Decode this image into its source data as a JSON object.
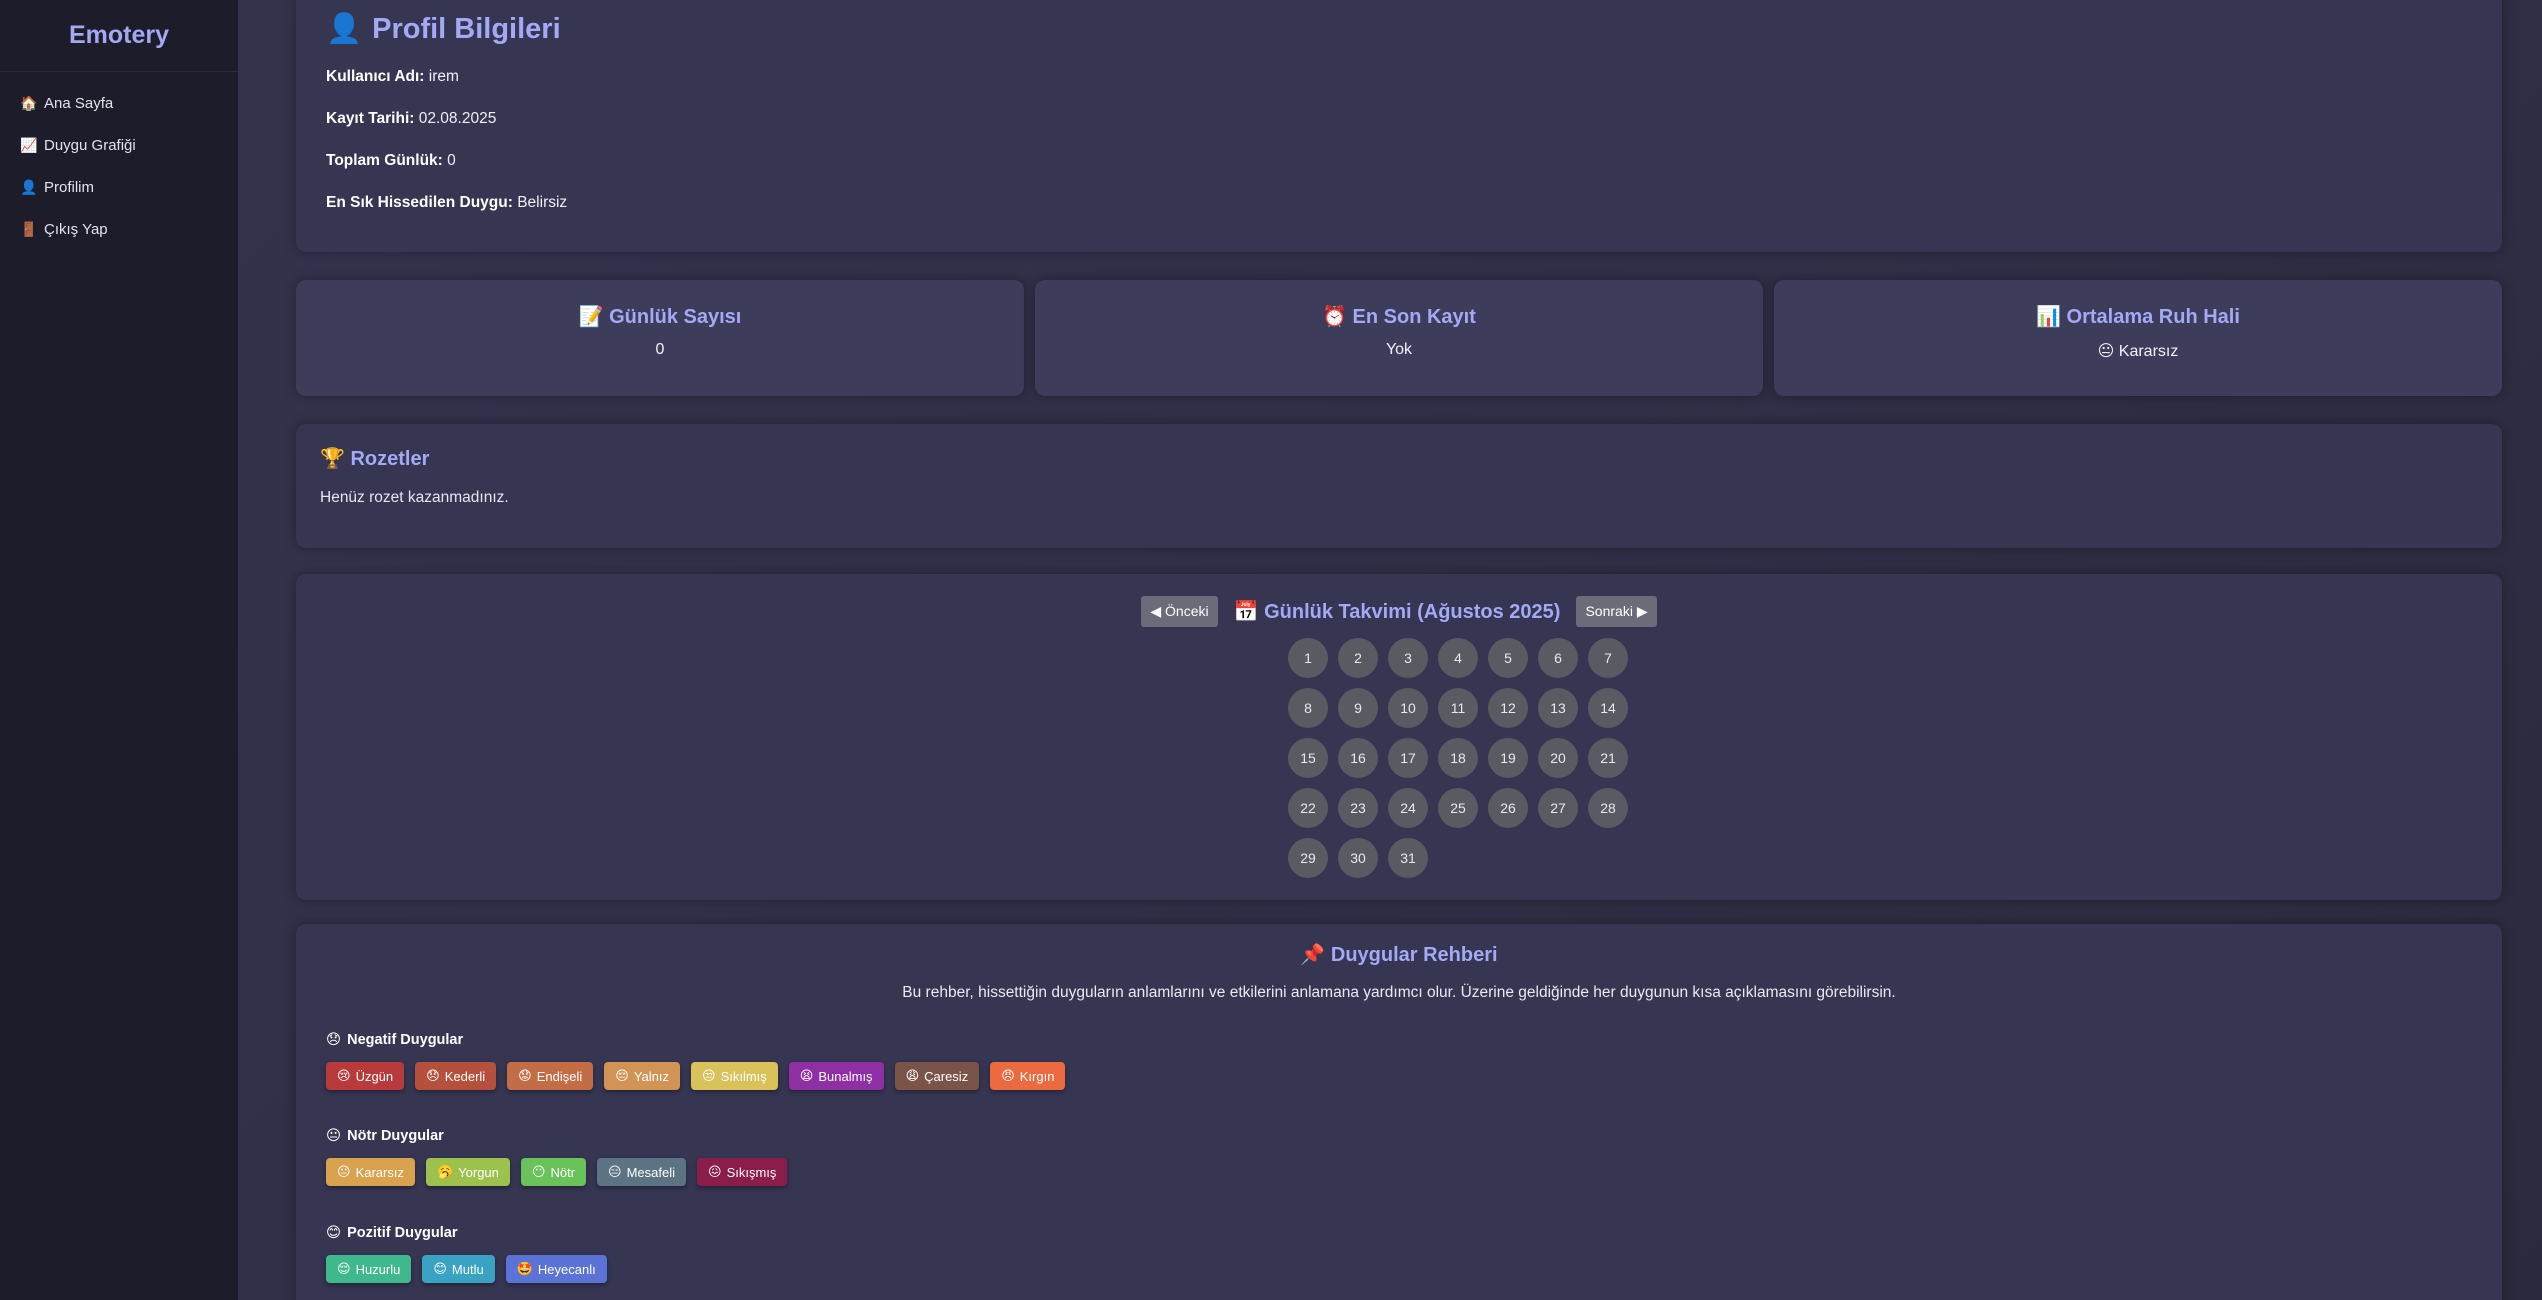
{
  "sidebar": {
    "brand": "Emotery",
    "items": [
      {
        "icon": "🏠",
        "label": "Ana Sayfa"
      },
      {
        "icon": "📈",
        "label": "Duygu Grafiği"
      },
      {
        "icon": "👤",
        "label": "Profilim"
      },
      {
        "icon": "🚪",
        "label": "Çıkış Yap"
      }
    ]
  },
  "profile": {
    "icon": "👤",
    "title": "Profil Bilgileri",
    "username_label": "Kullanıcı Adı:",
    "username": "irem",
    "register_label": "Kayıt Tarihi:",
    "register_date": "02.08.2025",
    "total_label": "Toplam Günlük:",
    "total": "0",
    "frequent_label": "En Sık Hissedilen Duygu:",
    "frequent": "Belirsiz"
  },
  "stats": [
    {
      "icon": "📝",
      "title": "Günlük Sayısı",
      "value": "0"
    },
    {
      "icon": "⏰",
      "title": "En Son Kayıt",
      "value": "Yok"
    },
    {
      "icon": "📊",
      "title": "Ortalama Ruh Hali",
      "value": "😐 Kararsız"
    }
  ],
  "badges": {
    "icon": "🏆",
    "title": "Rozetler",
    "empty_text": "Henüz rozet kazanmadınız."
  },
  "calendar": {
    "prev_label": "◀ Önceki",
    "next_label": "Sonraki ▶",
    "icon": "📅",
    "title": "Günlük Takvimi (Ağustos 2025)",
    "days": [
      "1",
      "2",
      "3",
      "4",
      "5",
      "6",
      "7",
      "8",
      "9",
      "10",
      "11",
      "12",
      "13",
      "14",
      "15",
      "16",
      "17",
      "18",
      "19",
      "20",
      "21",
      "22",
      "23",
      "24",
      "25",
      "26",
      "27",
      "28",
      "29",
      "30",
      "31"
    ]
  },
  "guide": {
    "icon": "📌",
    "title": "Duygular Rehberi",
    "description": "Bu rehber, hissettiğin duyguların anlamlarını ve etkilerini anlamana yardımcı olur. Üzerine geldiğinde her duygunun kısa açıklamasını görebilirsin.",
    "groups": [
      {
        "icon": "😞",
        "title": "Negatif Duygular",
        "items": [
          {
            "emoji": "😢",
            "label": "Üzgün",
            "color": "#b83a3a"
          },
          {
            "emoji": "😞",
            "label": "Kederli",
            "color": "#b5503c"
          },
          {
            "emoji": "😟",
            "label": "Endişeli",
            "color": "#c26d46"
          },
          {
            "emoji": "😔",
            "label": "Yalnız",
            "color": "#d19455"
          },
          {
            "emoji": "😒",
            "label": "Sıkılmış",
            "color": "#d9c25a"
          },
          {
            "emoji": "😫",
            "label": "Bunalmış",
            "color": "#8e2fa3"
          },
          {
            "emoji": "😩",
            "label": "Çaresiz",
            "color": "#7a5448"
          },
          {
            "emoji": "😠",
            "label": "Kırgın",
            "color": "#ec6a3f"
          }
        ]
      },
      {
        "icon": "😐",
        "title": "Nötr Duygular",
        "items": [
          {
            "emoji": "😐",
            "label": "Kararsız",
            "color": "#d9a24e"
          },
          {
            "emoji": "🥱",
            "label": "Yorgun",
            "color": "#9cc24d"
          },
          {
            "emoji": "😶",
            "label": "Nötr",
            "color": "#6ac25b"
          },
          {
            "emoji": "😑",
            "label": "Mesafeli",
            "color": "#5b7383"
          },
          {
            "emoji": "😖",
            "label": "Sıkışmış",
            "color": "#8a1d4a"
          }
        ]
      },
      {
        "icon": "😊",
        "title": "Pozitif Duygular",
        "items": [
          {
            "emoji": "😌",
            "label": "Huzurlu",
            "color": "#3fb88e"
          },
          {
            "emoji": "😊",
            "label": "Mutlu",
            "color": "#3aa3c4"
          },
          {
            "emoji": "🤩",
            "label": "Heyecanlı",
            "color": "#5b73d6"
          }
        ]
      }
    ]
  }
}
